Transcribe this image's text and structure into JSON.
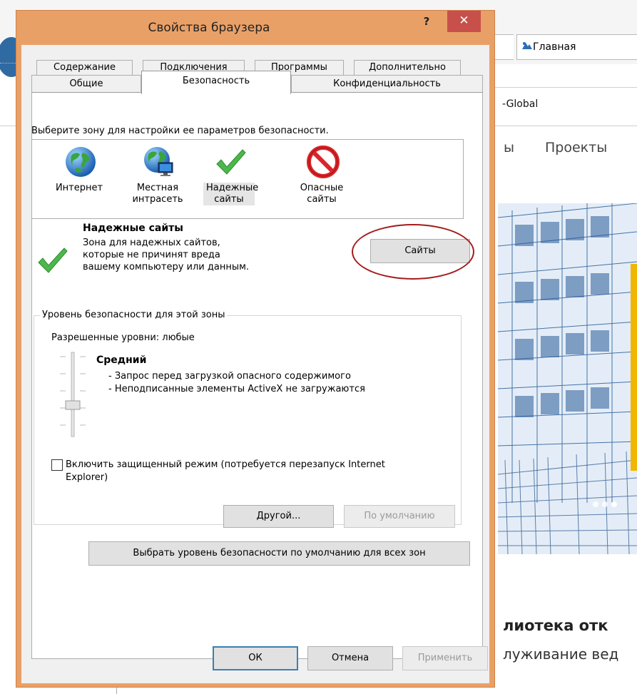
{
  "background": {
    "home_label": "Главная",
    "global_text": "-Global",
    "menu_partial": "ы",
    "menu_projects": "Проекты",
    "heading_partial": "лиотека отк",
    "subtext_partial": "луживание вед",
    "accent_color": "#f2b600"
  },
  "dialog": {
    "title": "Свойства браузера",
    "help_glyph": "?",
    "close_glyph": "✕",
    "tabs_row1": [
      "Содержание",
      "Подключения",
      "Программы",
      "Дополнительно"
    ],
    "tabs_row2": [
      "Общие",
      "Безопасность",
      "Конфиденциальность"
    ],
    "active_tab": "Безопасность",
    "zone_caption": "Выберите зону для настройки ее параметров безопасности.",
    "zones": [
      {
        "label": "Интернет",
        "icon": "globe-icon"
      },
      {
        "label": "Местная интрасеть",
        "icon": "intranet-globe-icon"
      },
      {
        "label": "Надежные сайты",
        "icon": "green-check-icon",
        "selected": true
      },
      {
        "label": "Опасные сайты",
        "icon": "restricted-icon"
      }
    ],
    "selected_zone": {
      "name": "Надежные сайты",
      "description": "Зона для надежных сайтов, которые не причинят вреда вашему компьютеру или данным."
    },
    "sites_button": "Сайты",
    "security_group": {
      "legend": "Уровень безопасности для этой зоны",
      "allowed_levels": "Разрешенные уровни: любые",
      "level_name": "Средний",
      "level_line1": "- Запрос перед загрузкой опасного содержимого",
      "level_line2": "- Неподписанные элементы ActiveX не загружаются"
    },
    "protected_mode": {
      "checked": false,
      "label": "Включить защищенный режим (потребуется перезапуск Internet Explorer)"
    },
    "custom_button": "Другой...",
    "default_button": "По умолчанию",
    "reset_all_button": "Выбрать уровень безопасности по умолчанию для всех зон",
    "ok_button": "ОК",
    "cancel_button": "Отмена",
    "apply_button": "Применить"
  }
}
